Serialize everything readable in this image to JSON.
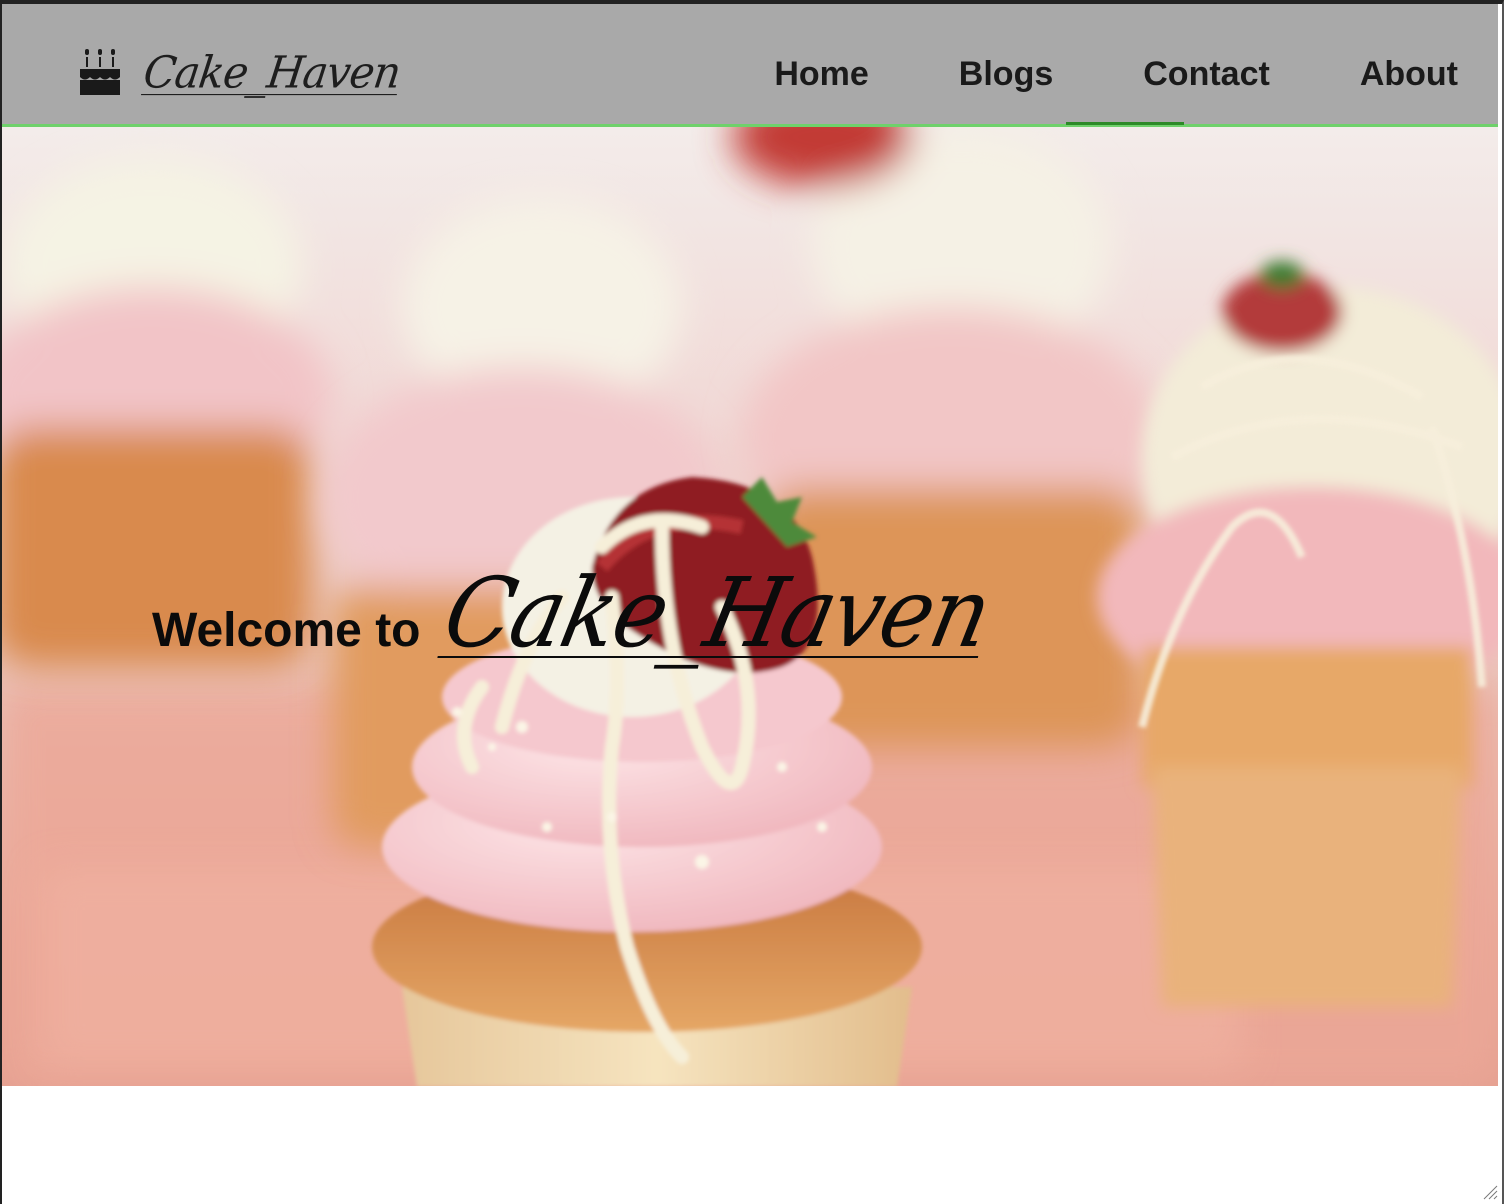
{
  "brand": {
    "name": "Cake_Haven",
    "icon": "birthday-cake-icon"
  },
  "nav": {
    "items": [
      {
        "label": "Home"
      },
      {
        "label": "Blogs"
      },
      {
        "label": "Contact"
      },
      {
        "label": "About"
      }
    ]
  },
  "hero": {
    "welcome": "Welcome to",
    "brand": "Cake_Haven",
    "background": "cupcakes-photo"
  },
  "colors": {
    "navbar": "#a9a9a9",
    "navbar_border": "#6fd16b",
    "text": "#1a1a1a"
  }
}
